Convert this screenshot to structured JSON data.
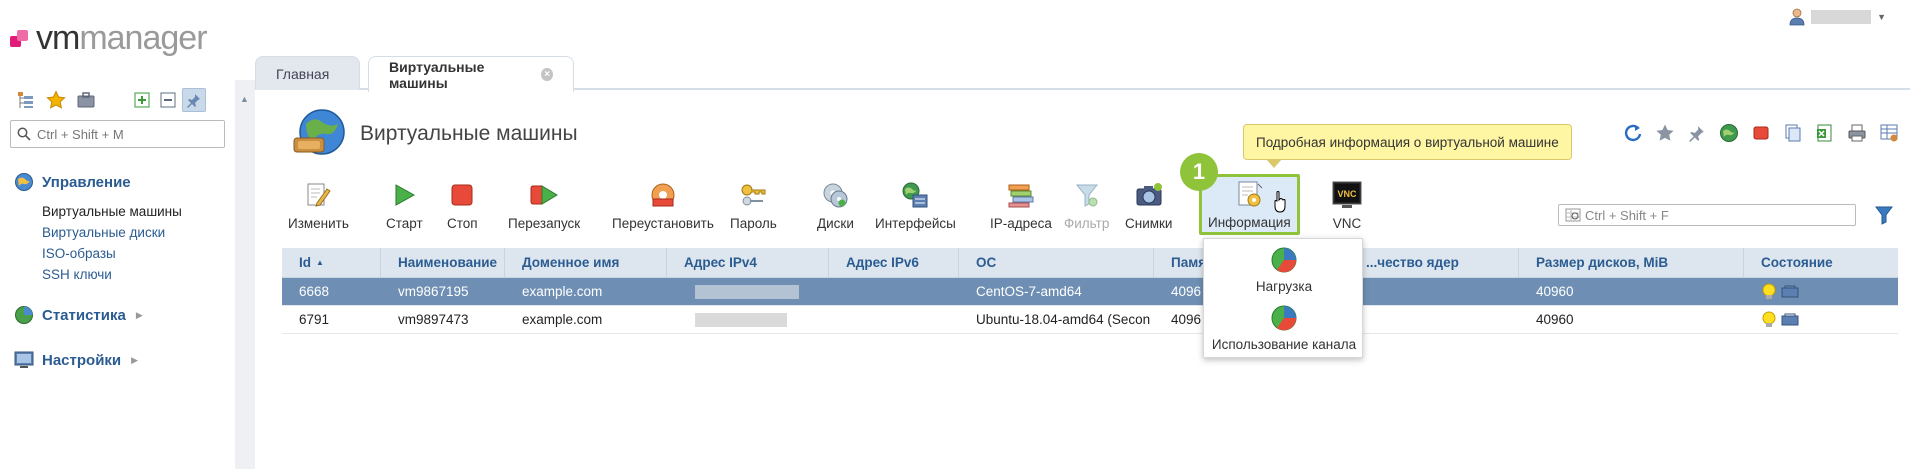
{
  "brand": {
    "vm": "vm",
    "manager": "manager"
  },
  "user": {
    "name": "████████"
  },
  "sidebar": {
    "search_placeholder": "Ctrl + Shift + M",
    "sections": {
      "management": "Управление",
      "statistics": "Статистика",
      "settings": "Настройки"
    },
    "items": [
      "Виртуальные машины",
      "Виртуальные диски",
      "ISO-образы",
      "SSH ключи"
    ]
  },
  "tabs": {
    "home": "Главная",
    "vms": "Виртуальные машины"
  },
  "page": {
    "title": "Виртуальные машины"
  },
  "tooltip": "Подробная информация о виртуальной машине",
  "badge": "1",
  "toolbar": {
    "edit": "Изменить",
    "start": "Старт",
    "stop": "Стоп",
    "restart": "Перезапуск",
    "reinstall": "Переустановить",
    "password": "Пароль",
    "disks": "Диски",
    "interfaces": "Интерфейсы",
    "ip": "IP-адреса",
    "filter": "Фильтр",
    "snapshots": "Снимки",
    "info": "Информация",
    "vnc": "VNC"
  },
  "table_search_placeholder": "Ctrl + Shift + F",
  "table": {
    "columns": [
      "Id",
      "Наименование",
      "Доменное имя",
      "Адрес IPv4",
      "Адрес IPv6",
      "ОС",
      "Памя",
      "...чество ядер",
      "Размер дисков, MiB",
      "Состояние"
    ],
    "rows": [
      {
        "id": "6668",
        "name": "vm9867195",
        "domain": "example.com",
        "ipv4": "",
        "ipv6": "",
        "os": "CentOS-7-amd64",
        "mem": "4096",
        "cores": "",
        "disk": "40960"
      },
      {
        "id": "6791",
        "name": "vm9897473",
        "domain": "example.com",
        "ipv4": "",
        "ipv6": "",
        "os": "Ubuntu-18.04-amd64 (Secon",
        "mem": "4096",
        "cores": "",
        "disk": "40960"
      }
    ]
  },
  "dropdown": {
    "load": "Нагрузка",
    "channel": "Использование канала"
  },
  "colors": {
    "accent": "#2b5c91",
    "highlight": "#8fc43a",
    "selected_row": "#6e8fb3",
    "tooltip": "#fff6a4"
  }
}
